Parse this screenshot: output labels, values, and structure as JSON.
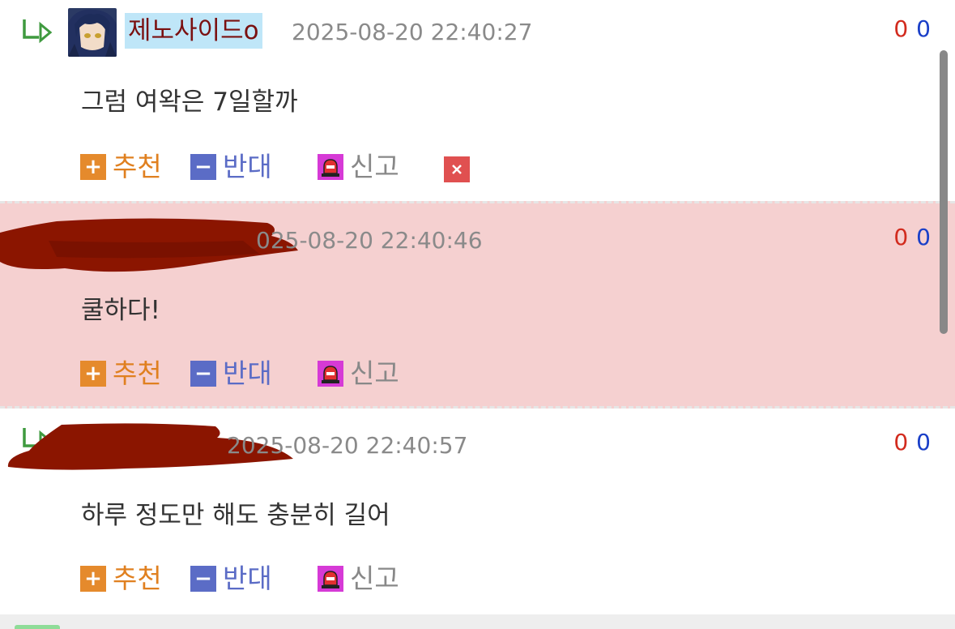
{
  "comments": [
    {
      "nickname": "제노사이드o",
      "datetime": "2025-08-20 22:40:27",
      "votes_up": "0",
      "votes_down": "0",
      "text": "그럼 여왁은 7일할까",
      "has_delete": true
    },
    {
      "nickname": "",
      "datetime": "025-08-20 22:40:46",
      "votes_up": "0",
      "votes_down": "0",
      "text": "쿨하다!",
      "has_delete": false
    },
    {
      "nickname": "",
      "datetime": "2025-08-20 22:40:57",
      "votes_up": "0",
      "votes_down": "0",
      "text": "하루 정도만 해도 충분히 길어",
      "has_delete": false
    }
  ],
  "actions": {
    "recommend_label": "추천",
    "oppose_label": "반대",
    "report_label": "신고"
  },
  "colors": {
    "recommend": "#e08020",
    "oppose": "#5b6cc6",
    "report_icon": "#d63ad6",
    "delete": "#e05050",
    "highlight_row": "#f5d0d0",
    "nickname_highlight": "#bfe6f8",
    "redaction": "#8b1500"
  },
  "icons": {
    "reply": "reply-arrow-icon",
    "recommend": "plus-icon",
    "oppose": "minus-icon",
    "report": "siren-icon",
    "delete": "close-icon"
  }
}
